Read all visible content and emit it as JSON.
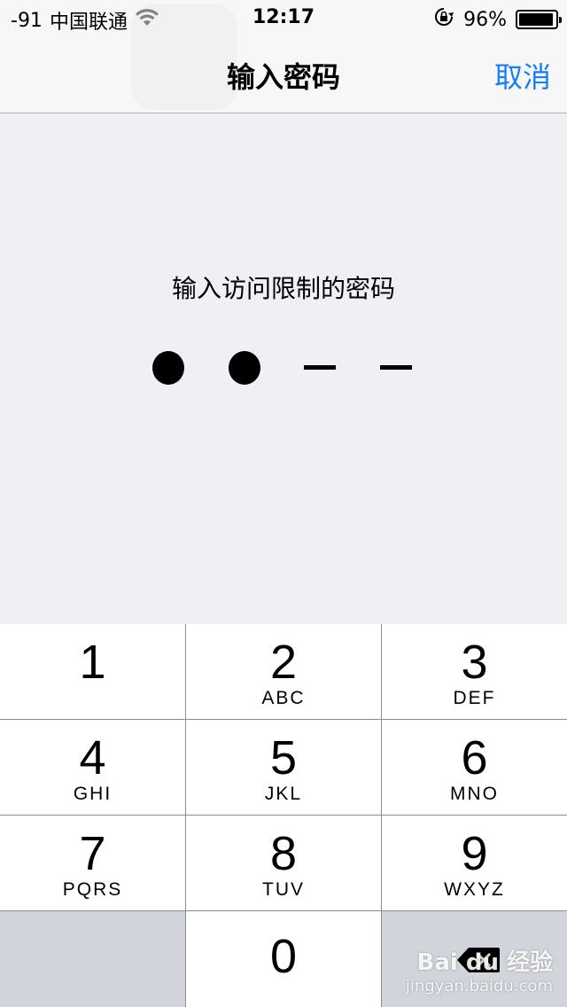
{
  "status_bar": {
    "signal": "-91",
    "carrier": "中国联通",
    "time": "12:17",
    "battery": "96%",
    "battery_level": 0.96
  },
  "nav": {
    "title": "输入密码",
    "cancel_label": "取消"
  },
  "prompt": "输入访问限制的密码",
  "passcode": {
    "entered": 2,
    "length": 4
  },
  "keypad": {
    "keys": [
      {
        "digit": "1",
        "letters": ""
      },
      {
        "digit": "2",
        "letters": "ABC"
      },
      {
        "digit": "3",
        "letters": "DEF"
      },
      {
        "digit": "4",
        "letters": "GHI"
      },
      {
        "digit": "5",
        "letters": "JKL"
      },
      {
        "digit": "6",
        "letters": "MNO"
      },
      {
        "digit": "7",
        "letters": "PQRS"
      },
      {
        "digit": "8",
        "letters": "TUV"
      },
      {
        "digit": "9",
        "letters": "WXYZ"
      },
      {
        "digit": "0",
        "letters": ""
      }
    ]
  },
  "watermark": {
    "brand": "Bai du 经验",
    "url": "jingyan.baidu.com"
  },
  "colors": {
    "accent": "#157efb",
    "background": "#efeff4",
    "key_dark": "#d1d4da"
  }
}
